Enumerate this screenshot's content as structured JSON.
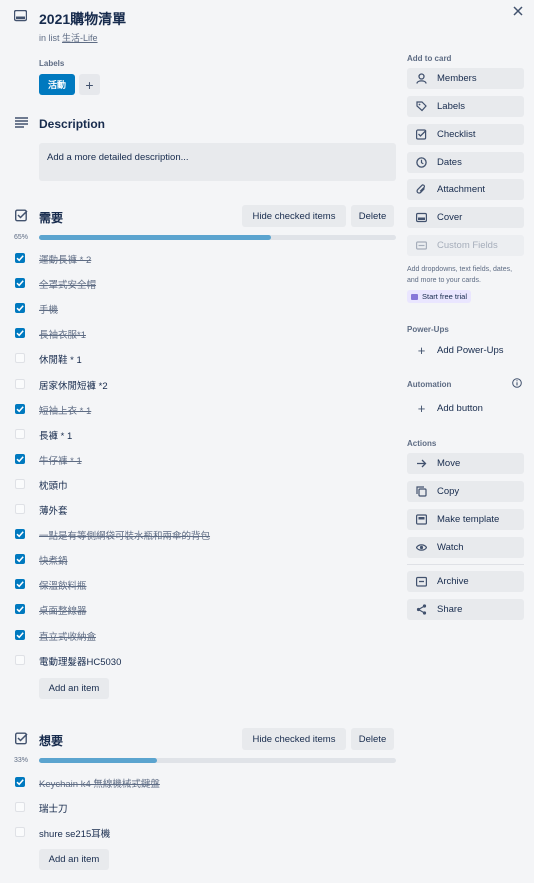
{
  "card": {
    "title": "2021購物清單",
    "in_list_prefix": "in list",
    "list_name": "生活-Life",
    "labels_heading": "Labels",
    "label_chip": "活動",
    "add_label_glyph": "+",
    "description_heading": "Description",
    "description_placeholder": "Add a more detailed description..."
  },
  "checklists": [
    {
      "title": "需要",
      "percent_text": "65%",
      "percent": 65,
      "hide_checked_label": "Hide checked items",
      "delete_label": "Delete",
      "add_item_label": "Add an item",
      "items": [
        {
          "text": "運動長褲 * 2",
          "checked": true
        },
        {
          "text": "全罩式安全帽",
          "checked": true
        },
        {
          "text": "手機",
          "checked": true
        },
        {
          "text": "長袖衣服*1",
          "checked": true
        },
        {
          "text": "休閒鞋 * 1",
          "checked": false
        },
        {
          "text": "居家休閒短褲 *2",
          "checked": false
        },
        {
          "text": "短袖上衣 * 1",
          "checked": true
        },
        {
          "text": "長褲 * 1",
          "checked": false
        },
        {
          "text": "牛仔褲 * 1",
          "checked": true
        },
        {
          "text": "枕頭巾",
          "checked": false
        },
        {
          "text": "薄外套",
          "checked": false
        },
        {
          "text": "一點是有等側網袋可裝水瓶和兩傘的背包",
          "checked": true
        },
        {
          "text": "快煮鍋",
          "checked": true
        },
        {
          "text": "保溫飲料瓶",
          "checked": true
        },
        {
          "text": "桌面整線器",
          "checked": true
        },
        {
          "text": "直立式收納盒",
          "checked": true
        },
        {
          "text": "電動理髮器HC5030",
          "checked": false
        }
      ]
    },
    {
      "title": "想要",
      "percent_text": "33%",
      "percent": 33,
      "hide_checked_label": "Hide checked items",
      "delete_label": "Delete",
      "add_item_label": "Add an item",
      "items": [
        {
          "text": "Keychain k4 無線機械式鍵盤",
          "checked": true
        },
        {
          "text": "瑞士刀",
          "checked": false
        },
        {
          "text": "shure se215耳機",
          "checked": false
        }
      ]
    }
  ],
  "sidebar": {
    "add_to_card_heading": "Add to card",
    "add_to_card": [
      {
        "label": "Members",
        "icon": "person-icon"
      },
      {
        "label": "Labels",
        "icon": "tag-icon"
      },
      {
        "label": "Checklist",
        "icon": "checklist-icon"
      },
      {
        "label": "Dates",
        "icon": "clock-icon"
      },
      {
        "label": "Attachment",
        "icon": "paperclip-icon"
      },
      {
        "label": "Cover",
        "icon": "cover-icon"
      }
    ],
    "custom_fields_label": "Custom Fields",
    "custom_fields_hint": "Add dropdowns, text fields, dates, and more to your cards.",
    "start_trial_label": "Start free trial",
    "powerups_heading": "Power-Ups",
    "add_powerups_label": "Add Power-Ups",
    "automation_heading": "Automation",
    "add_button_label": "Add button",
    "actions_heading": "Actions",
    "actions": [
      {
        "label": "Move",
        "icon": "arrow-right-icon"
      },
      {
        "label": "Copy",
        "icon": "copy-icon"
      },
      {
        "label": "Make template",
        "icon": "template-icon"
      },
      {
        "label": "Watch",
        "icon": "eye-icon"
      }
    ],
    "actions2": [
      {
        "label": "Archive",
        "icon": "archive-icon"
      },
      {
        "label": "Share",
        "icon": "share-icon"
      }
    ]
  },
  "colors": {
    "accent": "#0079bf",
    "progress": "#5ba4cf",
    "background": "#f4f5f7"
  }
}
